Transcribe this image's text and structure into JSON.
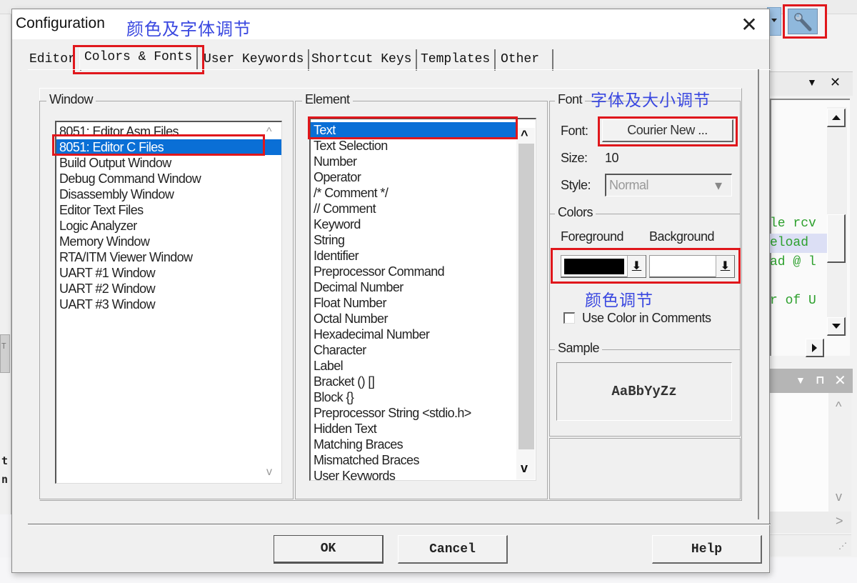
{
  "background_ide": {
    "left_tab_char": "T",
    "left_chars": [
      "t",
      "n"
    ],
    "code_lines": [
      "le rcv",
      "eload",
      "ad @ l",
      "",
      "r of U"
    ],
    "highlight_line_index": 1,
    "panel_icons": {
      "panel1": [
        "dropdown-icon",
        "close-icon"
      ],
      "panel2": [
        "dropdown-icon",
        "pin-icon",
        "close-icon"
      ]
    },
    "glyphs": {
      "dropdown": "▼",
      "close": "✕",
      "pin": "⊓",
      "up": "^",
      "down": "v",
      "right": ">",
      "grip": "⋰"
    }
  },
  "dialog": {
    "title": "Configuration",
    "title_annotation": "颜色及字体调节",
    "close_glyph": "✕",
    "tabs": [
      {
        "label": "Editor",
        "active": false
      },
      {
        "label": "Colors & Fonts",
        "active": true
      },
      {
        "label": "User Keywords",
        "active": false
      },
      {
        "label": "Shortcut Keys",
        "active": false
      },
      {
        "label": "Templates",
        "active": false
      },
      {
        "label": "Other",
        "active": false
      }
    ],
    "window_group": {
      "label": "Window",
      "items": [
        "8051: Editor Asm Files",
        "8051: Editor C Files",
        "Build Output Window",
        "Debug Command Window",
        "Disassembly Window",
        "Editor Text Files",
        "Logic Analyzer",
        "Memory Window",
        "RTA/ITM Viewer Window",
        "UART #1 Window",
        "UART #2 Window",
        "UART #3 Window"
      ],
      "selected_index": 1,
      "scroll_up_glyph": "^",
      "scroll_down_glyph": "v"
    },
    "element_group": {
      "label": "Element",
      "items": [
        "Text",
        "Text Selection",
        "Number",
        "Operator",
        "/* Comment */",
        "// Comment",
        "Keyword",
        "String",
        "Identifier",
        "Preprocessor Command",
        "Decimal Number",
        "Float Number",
        "Octal Number",
        "Hexadecimal Number",
        "Character",
        "Label",
        "Bracket () []",
        "Block {}",
        "Preprocessor String <stdio.h>",
        "Hidden Text",
        "Matching Braces",
        "Mismatched Braces",
        "User Keywords"
      ],
      "selected_index": 0,
      "scroll_up_glyph": "^",
      "scroll_down_glyph": "v"
    },
    "font_group": {
      "label": "Font",
      "annotation": "字体及大小调节",
      "font_label": "Font:",
      "font_value": "Courier New ...",
      "size_label": "Size:",
      "size_value": "10",
      "style_label": "Style:",
      "style_value": "Normal",
      "style_arrow": "▾"
    },
    "colors_group": {
      "label": "Colors",
      "foreground_label": "Foreground",
      "background_label": "Background",
      "foreground_color": "#000000",
      "background_color": "#ffffff",
      "arrow_glyph": "⬇",
      "annotation": "颜色调节",
      "use_color_in_comments_label": "Use Color in Comments",
      "use_color_in_comments_checked": false
    },
    "sample_group": {
      "label": "Sample",
      "sample_text": "AaBbYyZz"
    },
    "buttons": {
      "ok": "OK",
      "cancel": "Cancel",
      "help": "Help"
    }
  },
  "colors": {
    "highlight_red": "#e0171c",
    "annotation_blue": "#3a48e0",
    "selection_blue": "#0a6fd6",
    "code_green": "#2da02d",
    "toolbar_blue": "#8fb8dc"
  }
}
